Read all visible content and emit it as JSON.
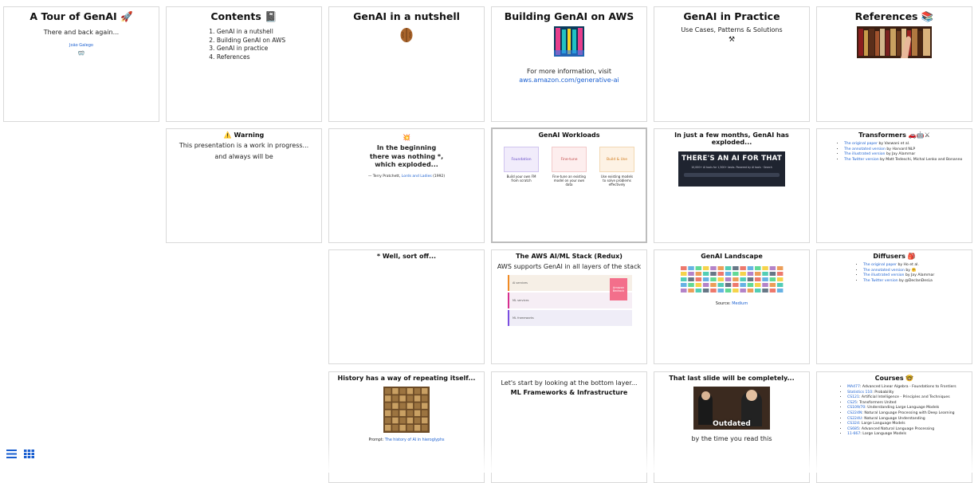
{
  "slides": {
    "tour": {
      "title": "A Tour of GenAI 🚀",
      "subtitle": "There and back again...",
      "author": "João Galego",
      "emoji": "🥽"
    },
    "contents": {
      "title": "Contents 📓",
      "items": [
        "GenAI in a nutshell",
        "Building GenAI on AWS",
        "GenAI in practice",
        "References"
      ]
    },
    "nutshell": {
      "title": "GenAI in a nutshell"
    },
    "building": {
      "title": "Building GenAI on AWS",
      "more": "For more information, visit",
      "link": "aws.amazon.com/generative-ai"
    },
    "practice": {
      "title": "GenAI in Practice",
      "subtitle": "Use Cases, Patterns & Solutions",
      "icon": "⚒"
    },
    "references": {
      "title": "References 📚"
    },
    "warning": {
      "title": "⚠️ Warning",
      "line1": "This presentation is a work in progress...",
      "line2": "and always will be"
    },
    "beginning": {
      "icon": "💥",
      "line1": "In the beginning",
      "line2": "there was nothing *,",
      "line3": "which exploded...",
      "quote_prefix": "— Terry Pratchett,",
      "quote_link": "Lords and Ladies",
      "quote_year": "(1992)"
    },
    "workloads": {
      "title": "GenAI Workloads",
      "cards": [
        {
          "label": "Foundation",
          "text": "Build your own FM from scratch"
        },
        {
          "label": "Fine-tune",
          "text": "Fine-tune an existing model on your own data"
        },
        {
          "label": "Build & Use",
          "text": "Use existing models to solve problems effectively"
        }
      ]
    },
    "months": {
      "title": "In just a few months, GenAI has exploded...",
      "banner": "THERE'S AN AI FOR THAT",
      "bar_text": "10,000+ AI tools for 1,500+ tasks. Powered by AI tools · Search",
      "colors": {
        "banner": "#1f2430"
      }
    },
    "transformers": {
      "title": "Transformers 🚗🤖⚔",
      "items": [
        {
          "link": "The original paper",
          "rest": " by Vaswani et al."
        },
        {
          "link": "The annotated version",
          "rest": " by Harvard NLP"
        },
        {
          "link": "The illustrated version",
          "rest": " by Jay Alammar"
        },
        {
          "link": "The Twitter version",
          "rest": " by Matt Tedeschi, Michal Lenko and Bonanno"
        }
      ]
    },
    "sortoff": {
      "title": "* Well, sort off..."
    },
    "stack": {
      "title": "The AWS AI/ML Stack (Redux)",
      "subtitle": "AWS supports GenAI in all layers of the stack",
      "layers": [
        "AI services",
        "ML services",
        "ML frameworks"
      ],
      "badge": "Amazon Bedrock"
    },
    "landscape": {
      "title": "GenAI Landscape",
      "source_label": "Source:",
      "source_link": "Medium"
    },
    "diffusers": {
      "title": "Diffusers 🎒",
      "items": [
        {
          "link": "The original paper",
          "rest": " by Ho et al."
        },
        {
          "link": "The annotated version",
          "rest": " by 🤗"
        },
        {
          "link": "The illustrated version",
          "rest": " by Jay Alammar"
        },
        {
          "link": "The Twitter version",
          "rest": " by @DeclanDesLa"
        }
      ]
    },
    "history": {
      "title": "History has a way of repeating itself...",
      "prompt_label": "Prompt:",
      "prompt_link": "The history of AI in hieroglyphs"
    },
    "bottom": {
      "line1": "Let's start by looking at the bottom layer...",
      "line2": "ML Frameworks & Infrastructure"
    },
    "lastslide": {
      "title": "That last slide will be completely...",
      "meme": "Outdated",
      "caption": "by the time you read this"
    },
    "courses": {
      "title": "Courses 🤓",
      "items": [
        {
          "link": "MA477",
          "rest": ": Advanced Linear Algebra - Foundations to Frontiers"
        },
        {
          "link": "Statistics 110",
          "rest": ": Probability"
        },
        {
          "link": "CS121",
          "rest": ": Artificial Intelligence - Principles and Techniques"
        },
        {
          "link": "CS25",
          "rest": ": Transformers United"
        },
        {
          "link": "CS109/70",
          "rest": ": Understanding Large Language Models"
        },
        {
          "link": "CS224N",
          "rest": ": Natural Language Processing with Deep Learning"
        },
        {
          "link": "CS224U",
          "rest": ": Natural Language Understanding"
        },
        {
          "link": "CS324",
          "rest": ": Large Language Models"
        },
        {
          "link": "CS685",
          "rest": ": Advanced Natural Language Processing"
        },
        {
          "link": "11-667",
          "rest": ": Large Language Models"
        }
      ]
    }
  },
  "toolbar": {
    "list_icon": "list-view-icon",
    "grid_icon": "grid-view-icon",
    "accent": "#1a5fd0"
  }
}
